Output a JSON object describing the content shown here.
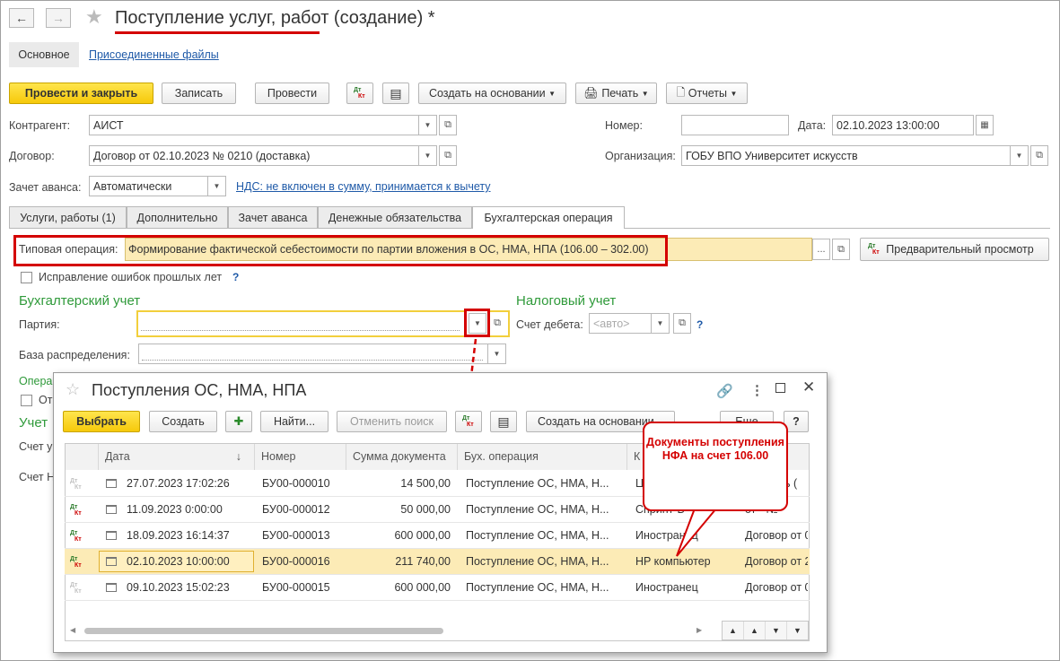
{
  "header": {
    "title": "Поступление услуг, работ (создание) *"
  },
  "top_tabs": {
    "main": "Основное",
    "files": "Присоединенные файлы"
  },
  "toolbar": {
    "post_close": "Провести и закрыть",
    "save": "Записать",
    "post": "Провести",
    "create_based": "Создать на основании",
    "print": "Печать",
    "reports": "Отчеты"
  },
  "form": {
    "counterparty_label": "Контрагент:",
    "counterparty_value": "АИСТ",
    "number_label": "Номер:",
    "number_value": "",
    "date_label": "Дата:",
    "date_value": "02.10.2023 13:00:00",
    "contract_label": "Договор:",
    "contract_value": "Договор от 02.10.2023 № 0210 (доставка)",
    "org_label": "Организация:",
    "org_value": "ГОБУ ВПО Университет искусств",
    "advance_label": "Зачет аванса:",
    "advance_value": "Автоматически",
    "vat_link": "НДС: не включен в сумму, принимается к вычету"
  },
  "tabs": [
    "Услуги, работы (1)",
    "Дополнительно",
    "Зачет аванса",
    "Денежные обязательства",
    "Бухгалтерская операция"
  ],
  "operation": {
    "label": "Типовая операция:",
    "value": "Формирование фактической себестоимости по партии вложения в ОС, НМА, НПА (106.00 – 302.00)",
    "preview": "Предварительный просмотр",
    "fix_errors": "Исправление ошибок прошлых лет",
    "help": "?"
  },
  "accounting": {
    "section": "Бухгалтерский учет",
    "batch_label": "Партия:",
    "batch_value": "",
    "base_label": "База распределения:",
    "base_value": "",
    "ops_label_partial": "Опера",
    "ot_partial": "От",
    "account_section_partial": "Учет",
    "account_u_partial": "Счет у",
    "account_n_partial": "Счет Н"
  },
  "tax": {
    "section": "Налоговый учет",
    "debit_label": "Счет дебета:",
    "debit_placeholder": "<авто>",
    "help": "?"
  },
  "popup": {
    "title": "Поступления ОС, НМА, НПА",
    "select": "Выбрать",
    "create": "Создать",
    "find": "Найти...",
    "cancel_search": "Отменить поиск",
    "create_based": "Создать на основании",
    "more_partial": "Еще",
    "help": "?",
    "columns": [
      "Дата",
      "Номер",
      "Сумма документа",
      "Бух. операция",
      "К"
    ],
    "rows": [
      {
        "date": "27.07.2023 17:02:26",
        "number": "БУ00-000010",
        "sum": "14 500,00",
        "op": "Поступление ОС, НМА, Н...",
        "k": "Ц",
        "extra": "сть ("
      },
      {
        "date": "11.09.2023 0:00:00",
        "number": "БУ00-000012",
        "sum": "50 000,00",
        "op": "Поступление ОС, НМА, Н...",
        "k": "Спринт-Б",
        "extra": "от - №"
      },
      {
        "date": "18.09.2023 16:14:37",
        "number": "БУ00-000013",
        "sum": "600 000,00",
        "op": "Поступление ОС, НМА, Н...",
        "k": "Иностранец",
        "extra": "Договор от 0"
      },
      {
        "date": "02.10.2023 10:00:00",
        "number": "БУ00-000016",
        "sum": "211 740,00",
        "op": "Поступление ОС, НМА, Н...",
        "k": "HP компьютер",
        "extra": "Договор от 2"
      },
      {
        "date": "09.10.2023 15:02:23",
        "number": "БУ00-000015",
        "sum": "600 000,00",
        "op": "Поступление ОС, НМА, Н...",
        "k": "Иностранец",
        "extra": "Договор от 0"
      }
    ]
  },
  "callout": {
    "text": "Документы поступления НФА на счет 106.00"
  },
  "colors": {
    "accent_yellow": "#f6c90a",
    "red_annotation": "#d40000",
    "green_section": "#2f9a3a",
    "selected_row": "#fcebb6"
  }
}
